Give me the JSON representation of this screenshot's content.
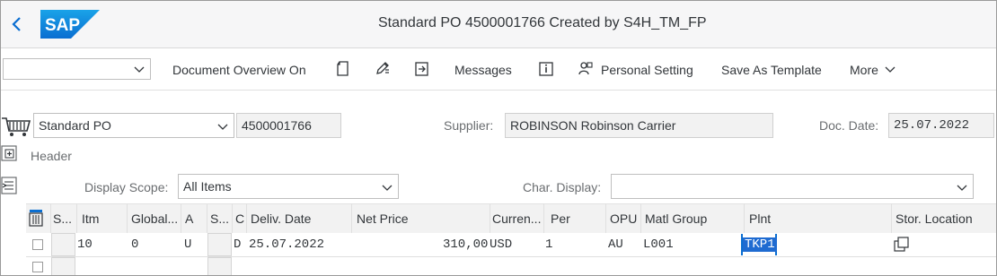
{
  "header": {
    "title": "Standard PO 4500001766 Created by S4H_TM_FP",
    "logo_text": "SAP",
    "brand_color": "#0a6ed1"
  },
  "toolbar": {
    "dropdown_value": "",
    "document_overview": "Document Overview On",
    "messages": "Messages",
    "personal_setting": "Personal Setting",
    "save_as_template": "Save As Template",
    "more": "More",
    "icons": [
      "document-icon",
      "edit-icon",
      "other-object-icon",
      "info-icon",
      "personal-setting-icon"
    ]
  },
  "po": {
    "type": "Standard PO",
    "number": "4500001766",
    "supplier_label": "Supplier:",
    "supplier_value": "ROBINSON Robinson Carrier",
    "doc_date_label": "Doc. Date:",
    "doc_date_value": "25.07.2022"
  },
  "section": {
    "header_label": "Header"
  },
  "scope": {
    "display_scope_label": "Display Scope:",
    "display_scope_value": "All Items",
    "char_display_label": "Char. Display:",
    "char_display_value": ""
  },
  "table": {
    "columns": [
      "S...",
      "Itm",
      "Global...",
      "A",
      "S...",
      "C",
      "Deliv. Date",
      "Net Price",
      "Curren...",
      "Per",
      "OPU",
      "Matl Group",
      "Plnt",
      "Stor. Location"
    ],
    "rows": [
      {
        "itm": "10",
        "global": "0",
        "a": "U",
        "c": "D",
        "deliv_date": "25.07.2022",
        "net_price": "310,00",
        "currency": "USD",
        "per": "1",
        "opu": "AU",
        "matl_group": "L001",
        "plnt": "TKP1",
        "stor_location": ""
      }
    ]
  }
}
